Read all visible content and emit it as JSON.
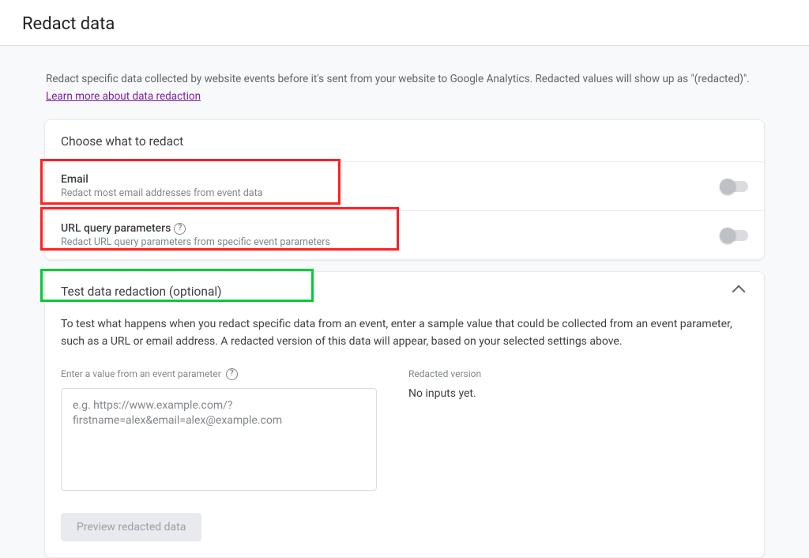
{
  "header": {
    "title": "Redact data"
  },
  "intro": {
    "text_before_link": "Redact specific data collected by website events before it's sent from your website to Google Analytics. Redacted values will show up as \"(redacted)\". ",
    "link_text": "Learn more about data redaction"
  },
  "choose_card": {
    "title": "Choose what to redact",
    "rows": [
      {
        "title": "Email",
        "subtitle": "Redact most email addresses from event data",
        "has_help_icon": false,
        "toggled": false
      },
      {
        "title": "URL query parameters",
        "subtitle": "Redact URL query parameters from specific event parameters",
        "has_help_icon": true,
        "toggled": false
      }
    ]
  },
  "test_card": {
    "title": "Test data redaction (optional)",
    "description": "To test what happens when you redact specific data from an event, enter a sample value that could be collected from an event parameter, such as a URL or email address. A redacted version of this data will appear, based on your selected settings above.",
    "input_label": "Enter a value from an event parameter",
    "input_placeholder": "e.g. https://www.example.com/?firstname=alex&email=alex@example.com",
    "redacted_label": "Redacted version",
    "redacted_value": "No inputs yet.",
    "preview_button": "Preview redacted data"
  }
}
